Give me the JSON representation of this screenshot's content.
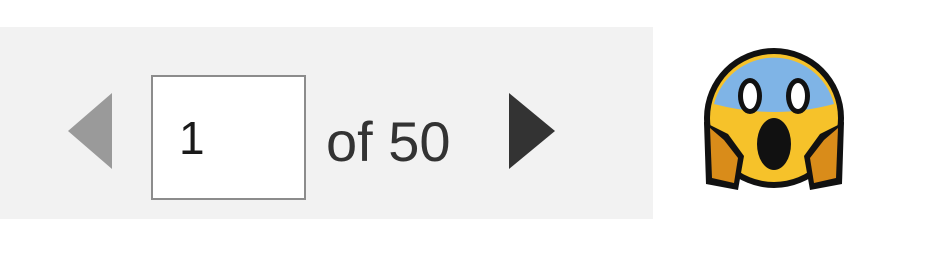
{
  "pager": {
    "current_page": "1",
    "total_label": "of 50",
    "prev_icon": "chevron-left-icon",
    "next_icon": "chevron-right-icon"
  },
  "colors": {
    "bar_background": "#f2f2f2",
    "prev_disabled": "#9a9a9a",
    "next_enabled": "#333333",
    "input_border": "#8c8c8c"
  },
  "emoji": {
    "name": "face-screaming-in-fear-icon"
  }
}
